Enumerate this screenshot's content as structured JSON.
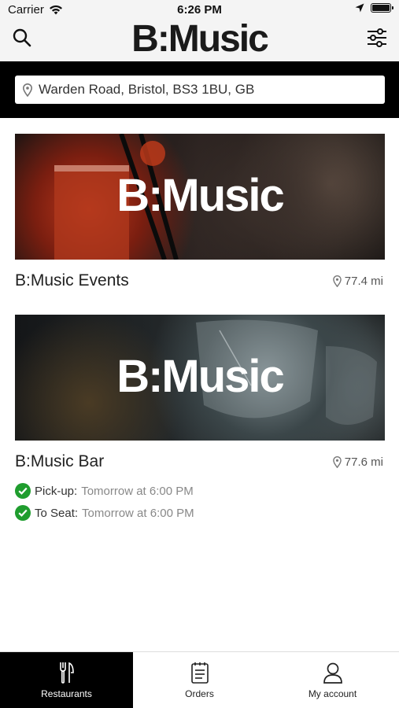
{
  "status_bar": {
    "carrier": "Carrier",
    "time": "6:26 PM"
  },
  "header": {
    "logo": "B:Music",
    "search_icon": "search-icon",
    "filter_icon": "sliders-icon"
  },
  "location": {
    "value": "Warden Road, Bristol, BS3 1BU, GB",
    "icon": "map-pin-icon"
  },
  "venues": [
    {
      "banner_brand": "B:Music",
      "name": "B:Music Events",
      "distance": "77.4 mi"
    },
    {
      "banner_brand": "B:Music",
      "name": "B:Music Bar",
      "distance": "77.6 mi",
      "details": [
        {
          "label": "Pick-up:",
          "value": "Tomorrow at 6:00 PM"
        },
        {
          "label": "To Seat:",
          "value": "Tomorrow at 6:00 PM"
        }
      ]
    }
  ],
  "tabs": [
    {
      "label": "Restaurants",
      "icon": "fork-knife-icon",
      "active": true
    },
    {
      "label": "Orders",
      "icon": "clipboard-icon",
      "active": false
    },
    {
      "label": "My account",
      "icon": "user-icon",
      "active": false
    }
  ],
  "colors": {
    "accent": "#000000",
    "check": "#1f9d2e",
    "header_bg": "#f4f4f4"
  }
}
